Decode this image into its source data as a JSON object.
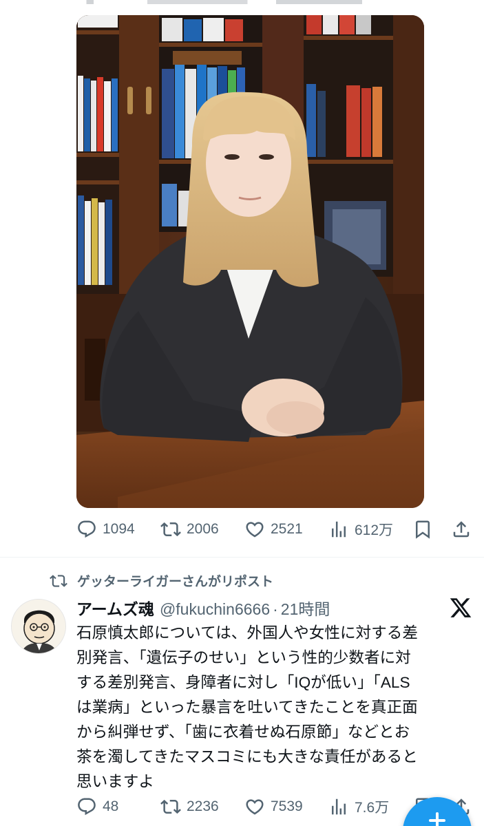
{
  "post1": {
    "media_alt": "photo",
    "metrics": {
      "replies": "1094",
      "reposts": "2006",
      "likes": "2521",
      "views": "612万"
    }
  },
  "post2": {
    "repost_label": "ゲッターライガーさんがリポスト",
    "author_name": "アームズ魂",
    "author_handle": "@fukuchin6666",
    "separator": "·",
    "time": "21時間",
    "text_lines": [
      "石原慎太郎については、外国人や女性に対する差",
      "別発言、「遺伝子のせい」という性的少数者に対",
      "する差別発言、身障者に対し「IQが低い」「ALS",
      "は業病」といった暴言を吐いてきたことを真正面",
      "から糾弾せず、「歯に衣着せぬ石原節」などとお",
      "茶を濁してきたマスコミにも大きな責任があると",
      "思いますよ"
    ],
    "metrics": {
      "replies": "48",
      "reposts": "2236",
      "likes": "7539",
      "views": "7.6万"
    }
  },
  "colors": {
    "muted": "#536471",
    "text": "#0f1419",
    "accent": "#1d9bf0",
    "divider": "#eff3f4"
  },
  "icons": [
    "reply-icon",
    "repost-icon",
    "like-icon",
    "views-icon",
    "bookmark-icon",
    "share-icon",
    "x-logo-icon",
    "compose-icon"
  ]
}
